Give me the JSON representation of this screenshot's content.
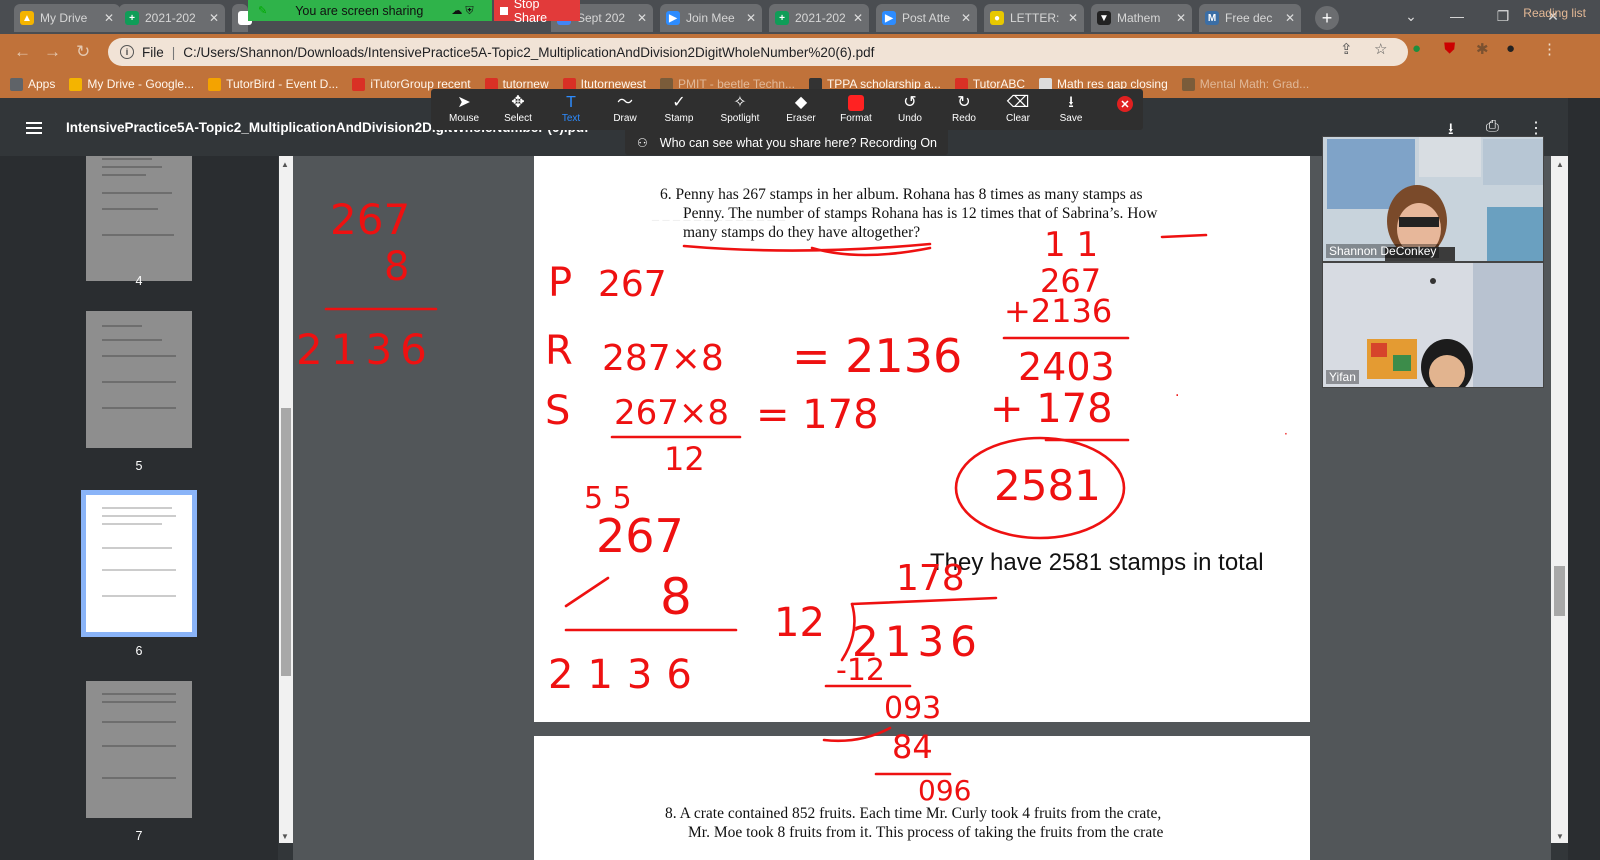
{
  "browser": {
    "tabs": [
      {
        "title": "My Drive",
        "color": "#f4b400",
        "glyph": "▲"
      },
      {
        "title": "2021-202",
        "color": "#0f9d58",
        "glyph": "+"
      },
      {
        "title": "",
        "color": "#ffffff",
        "glyph": ""
      },
      {
        "title": "Sept 202",
        "color": "#4285f4",
        "glyph": "■"
      },
      {
        "title": "Join Mee",
        "color": "#2d8cff",
        "glyph": "▶"
      },
      {
        "title": "2021-202",
        "color": "#0f9d58",
        "glyph": "+"
      },
      {
        "title": "Post Atte",
        "color": "#2d8cff",
        "glyph": "▶"
      },
      {
        "title": "LETTER:",
        "color": "#e8c800",
        "glyph": "●"
      },
      {
        "title": "Mathem",
        "color": "#222222",
        "glyph": "▼"
      },
      {
        "title": "Free dec",
        "color": "#3b6ea5",
        "glyph": "M"
      }
    ],
    "new_tab": "+",
    "share_banner": "You are screen sharing",
    "stop_share": "Stop Share",
    "omnibox": {
      "scheme": "File",
      "url": "C:/Users/Shannon/Downloads/IntensivePractice5A-Topic2_MultiplicationAndDivision2DigitWholeNumber%20(6).pdf"
    },
    "bookmarks": [
      {
        "label": "Apps",
        "color": "#5f6368"
      },
      {
        "label": "My Drive - Google...",
        "color": "#f4b400"
      },
      {
        "label": "TutorBird - Event D...",
        "color": "#f4a300"
      },
      {
        "label": "iTutorGroup recent",
        "color": "#d93025"
      },
      {
        "label": "tutornew",
        "color": "#d93025"
      },
      {
        "label": "Itutornewest",
        "color": "#d93025"
      },
      {
        "label": "PMIT - beetle Techn...",
        "color": "#7a5c3a",
        "dim": true
      },
      {
        "label": "TPPA scholarship a...",
        "color": "#333333"
      },
      {
        "label": "TutorABC",
        "color": "#d93025"
      },
      {
        "label": "Math res gap closing",
        "color": "#dddddd"
      },
      {
        "label": "Mental Math: Grad...",
        "color": "#7a5c3a",
        "dim": true
      }
    ],
    "reading_list": "Reading list"
  },
  "pdf": {
    "title": "IntensivePractice5A-Topic2_MultiplicationAndDivision2DigitWholeNumber (6).pdf",
    "page_labels": [
      "4",
      "5",
      "6",
      "7"
    ],
    "current_page": "6",
    "question6_lines": [
      "6.  Penny has 267 stamps in her album. Rohana has 8 times as many stamps as",
      "Penny. The number of stamps Rohana has is 12 times that of Sabrina’s. How",
      "many stamps do they have altogether?"
    ],
    "question8_lines": [
      "8.  A crate contained 852 fruits. Each time Mr. Curly took 4 fruits from the crate,",
      "Mr. Moe took 8 fruits from it. This process of taking the fruits from the crate"
    ],
    "typed_answer": "They have 2581 stamps in total"
  },
  "annotation_toolbar": {
    "tools": [
      {
        "label": "Mouse",
        "icon": "pointer-icon"
      },
      {
        "label": "Select",
        "icon": "move-icon"
      },
      {
        "label": "Text",
        "icon": "text-icon",
        "active": true
      },
      {
        "label": "Draw",
        "icon": "draw-icon"
      },
      {
        "label": "Stamp",
        "icon": "check-stamp-icon"
      },
      {
        "label": "Spotlight",
        "icon": "spotlight-icon"
      },
      {
        "label": "Eraser",
        "icon": "eraser-icon"
      },
      {
        "label": "Format",
        "icon": "format-swatch-icon"
      },
      {
        "label": "Undo",
        "icon": "undo-icon"
      },
      {
        "label": "Redo",
        "icon": "redo-icon"
      },
      {
        "label": "Clear",
        "icon": "trash-icon"
      },
      {
        "label": "Save",
        "icon": "save-icon"
      }
    ],
    "format_color": "#ff2222",
    "recording_notice": "Who can see what you share here? Recording On"
  },
  "participants": [
    {
      "name": "Shannon DeConkey"
    },
    {
      "name": "Yifan"
    }
  ],
  "ink": {
    "color": "#ee1111",
    "left_work": {
      "multiplicand": "267",
      "multiplier": "8",
      "product": "2136",
      "rows": [
        {
          "label": "P",
          "expr": "267"
        },
        {
          "label": "R",
          "expr": "287×8",
          "result": "= 2136"
        },
        {
          "label": "S",
          "expr": "267×8",
          "divisor": "12",
          "result": "= 178"
        }
      ],
      "carry": "5  5",
      "multiplicand2": "267",
      "multiplier2": "8",
      "product2": "2136"
    },
    "right_work": {
      "carry": "1 1",
      "addend1": "267",
      "addend2": "+2136",
      "subtotal": "2403",
      "addend3": "+ 178",
      "total": "2581"
    },
    "division": {
      "quotient": "178",
      "divisor": "12",
      "dividend": "2136",
      "sub1": "-12",
      "rem1": "093",
      "sub2": "84",
      "rem2": "096"
    }
  }
}
